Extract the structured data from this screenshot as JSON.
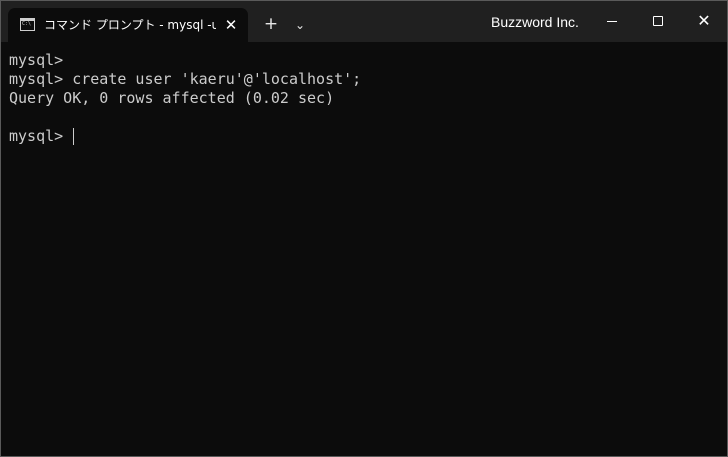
{
  "titlebar": {
    "tab_title": "コマンド プロンプト - mysql  -u root -p",
    "tab_icon": "cmd-icon",
    "tab_close_icon": "close-icon",
    "new_tab_icon": "plus-icon",
    "dropdown_icon": "chevron-down-icon",
    "org_name": "Buzzword Inc.",
    "minimize_icon": "minimize-icon",
    "maximize_icon": "maximize-icon",
    "close_icon": "close-icon"
  },
  "terminal": {
    "lines": [
      "mysql>",
      "mysql> create user 'kaeru'@'localhost';",
      "Query OK, 0 rows affected (0.02 sec)",
      "",
      "mysql>"
    ],
    "colors": {
      "background": "#0c0c0c",
      "text": "#cccccc",
      "titlebar": "#202020"
    }
  }
}
